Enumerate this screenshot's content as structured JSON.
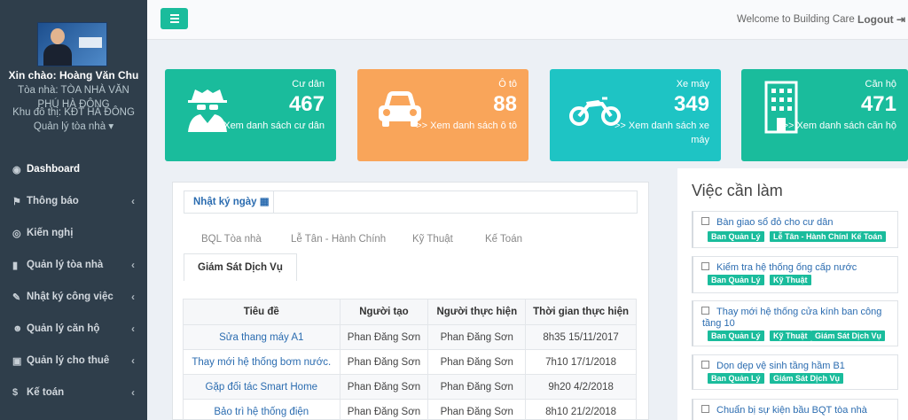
{
  "sidebar": {
    "greeting": "Xin chào: Hoàng Văn Chu",
    "building_line1": "Tòa nhà: TÒA NHÀ VĂN",
    "building_line2": "PHÚ HÀ ĐÔNG",
    "area": "Khu đô thị: KĐT HÀ ĐÔNG",
    "role": "Quản lý tòa nhà",
    "menu": [
      {
        "label": "Dashboard",
        "icon": "dashboard-icon"
      },
      {
        "label": "Thông báo",
        "icon": "flag-icon"
      },
      {
        "label": "Kiến nghị",
        "icon": "target-icon"
      },
      {
        "label": "Quản lý tòa nhà",
        "icon": "building-icon"
      },
      {
        "label": "Nhật ký công việc",
        "icon": "edit-icon"
      },
      {
        "label": "Quản lý căn hộ",
        "icon": "users-icon"
      },
      {
        "label": "Quản lý cho thuê",
        "icon": "briefcase-icon"
      },
      {
        "label": "Kế toán",
        "icon": "dollar-icon"
      }
    ]
  },
  "topbar": {
    "welcome": "Welcome to Building Care",
    "logout": "Logout"
  },
  "stats": [
    {
      "label": "Cư dân",
      "value": "467",
      "link": ">> Xem danh sách cư dân",
      "color": "#1abc9c",
      "icon": "spy-icon"
    },
    {
      "label": "Ô tô",
      "value": "88",
      "link": ">> Xem danh sách ô tô",
      "color": "#f9a55a",
      "icon": "car-icon"
    },
    {
      "label": "Xe máy",
      "value": "349",
      "link": ">> Xem danh sách xe máy",
      "color": "#1ec4c4",
      "icon": "motorcycle-icon"
    },
    {
      "label": "Căn hộ",
      "value": "471",
      "link": ">> Xem danh sách căn hộ",
      "color": "#1abc9c",
      "icon": "building-icon"
    }
  ],
  "diary": {
    "title": "Nhật ký ngày",
    "tabs": [
      "BQL Tòa nhà",
      "Lễ Tân - Hành Chính",
      "Kỹ Thuật",
      "Kế Toán",
      "Giám Sát Dịch Vụ"
    ],
    "columns": [
      "Tiêu đề",
      "Người tạo",
      "Người thực hiện",
      "Thời gian thực hiện"
    ],
    "rows": [
      [
        "Sửa thang máy A1",
        "Phan Đăng Sơn",
        "Phan Đăng Sơn",
        "8h35 15/11/2017"
      ],
      [
        "Thay mới hệ thống bơm nước.",
        "Phan Đăng Sơn",
        "Phan Đăng Sơn",
        "7h10 17/1/2018"
      ],
      [
        "Gặp đối tác Smart Home",
        "Phan Đăng Sơn",
        "Phan Đăng Sơn",
        "9h20 4/2/2018"
      ],
      [
        "Bảo trì hệ thống điện",
        "Phan Đăng Sơn",
        "Phan Đăng Sơn",
        "8h10 21/2/2018"
      ]
    ]
  },
  "todo": {
    "title": "Việc cần làm",
    "tasks": [
      {
        "text": "Bàn giao sổ đỏ cho cư dân",
        "tags": [
          "Ban Quản Lý",
          "Lễ Tân - Hành Chính",
          "Kế Toán"
        ]
      },
      {
        "text": "Kiểm tra hệ thống ống cấp nước",
        "tags": [
          "Ban Quản Lý",
          "Kỹ Thuật"
        ]
      },
      {
        "text": "Thay mới hệ thống cửa kính ban công tầng 10",
        "tags": [
          "Ban Quản Lý",
          "Kỹ Thuật",
          "Giám Sát Dịch Vụ"
        ]
      },
      {
        "text": "Dọn dẹp vệ sinh tầng hầm B1",
        "tags": [
          "Ban Quản Lý",
          "Giám Sát Dịch Vụ"
        ]
      },
      {
        "text": "Chuẩn bị sự kiện bầu BQT tòa nhà",
        "tags": []
      }
    ]
  }
}
